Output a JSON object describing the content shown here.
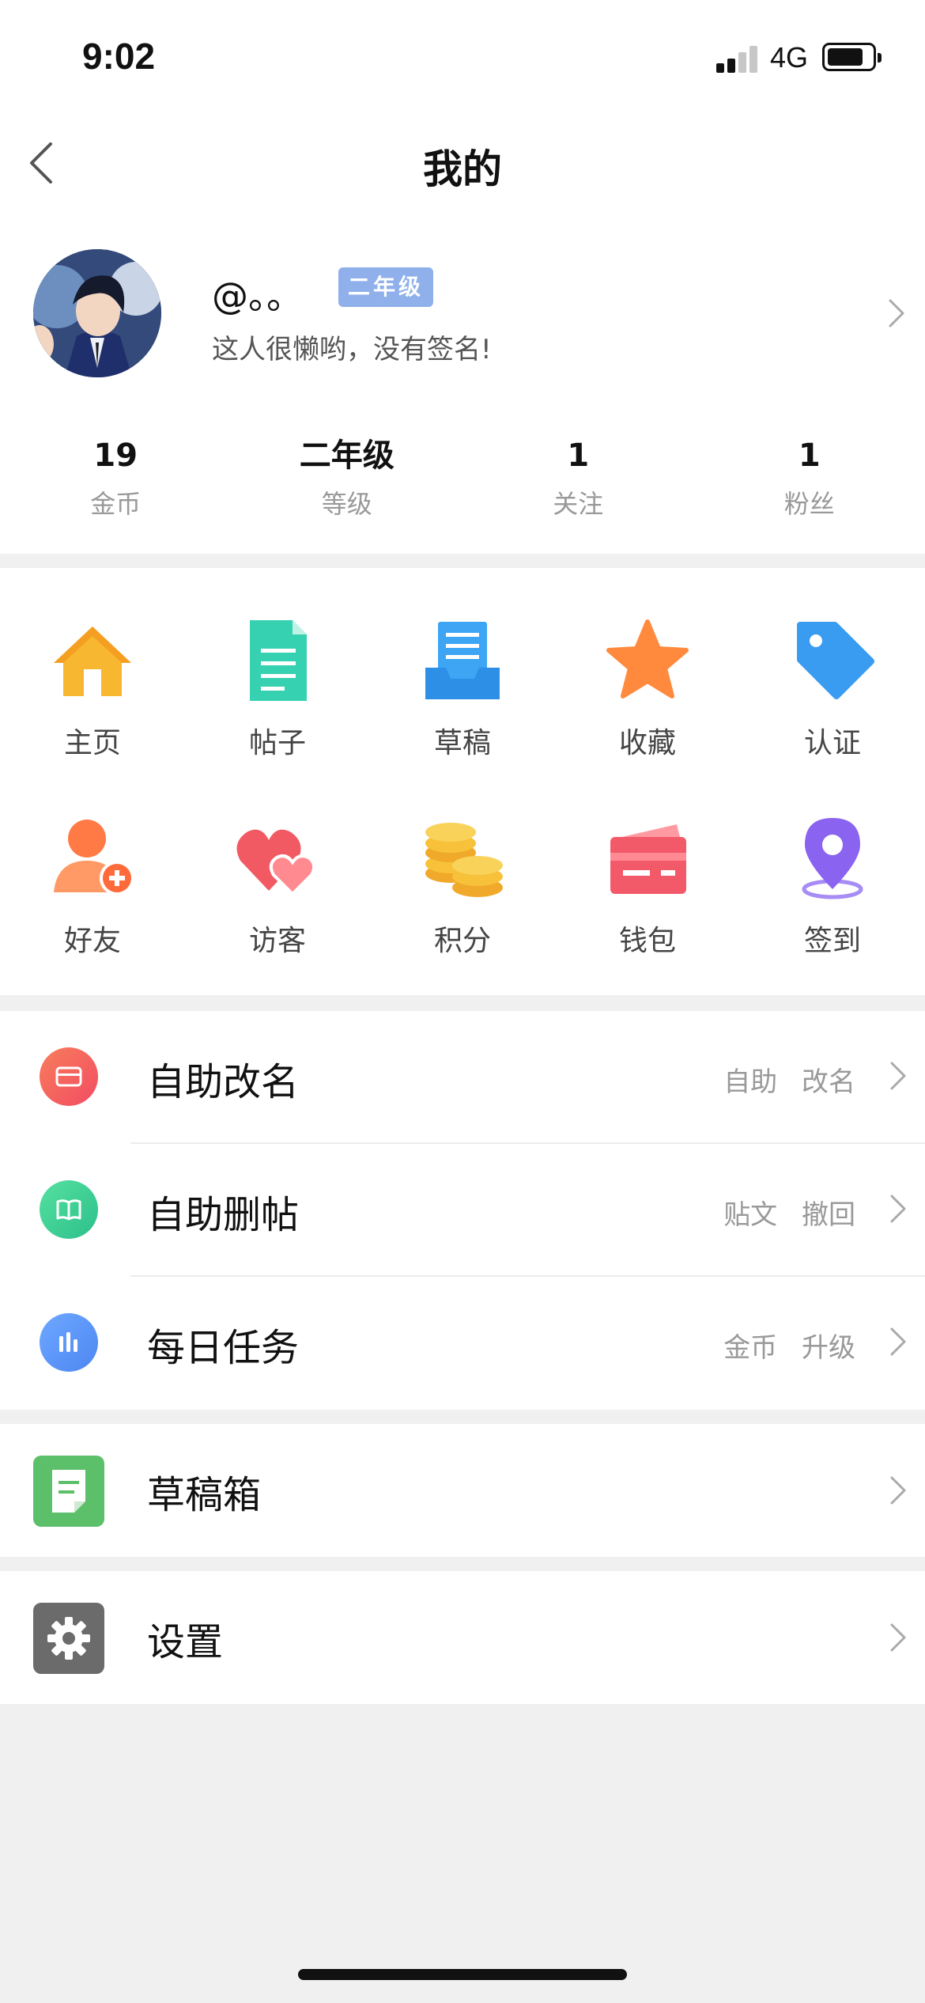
{
  "status": {
    "time": "9:02",
    "network": "4G"
  },
  "nav": {
    "title": "我的"
  },
  "profile": {
    "username": "@。。",
    "level_badge": "二年级",
    "signature": "这人很懒哟，没有签名!"
  },
  "stats": [
    {
      "value": "19",
      "label": "金币"
    },
    {
      "value": "二年级",
      "label": "等级"
    },
    {
      "value": "1",
      "label": "关注"
    },
    {
      "value": "1",
      "label": "粉丝"
    }
  ],
  "grid": [
    {
      "label": "主页",
      "icon": "home-icon",
      "color": "#f7b731"
    },
    {
      "label": "帖子",
      "icon": "document-icon",
      "color": "#36d1b0"
    },
    {
      "label": "草稿",
      "icon": "draft-tray-icon",
      "color": "#3da5f4"
    },
    {
      "label": "收藏",
      "icon": "star-icon",
      "color": "#ff8a3d"
    },
    {
      "label": "认证",
      "icon": "tag-icon",
      "color": "#3a9cf0"
    },
    {
      "label": "好友",
      "icon": "add-friend-icon",
      "color": "#ff7a45"
    },
    {
      "label": "访客",
      "icon": "hearts-icon",
      "color": "#f25a63"
    },
    {
      "label": "积分",
      "icon": "coins-icon",
      "color": "#f7c23a"
    },
    {
      "label": "钱包",
      "icon": "wallet-icon",
      "color": "#f25a6a"
    },
    {
      "label": "签到",
      "icon": "location-pin-icon",
      "color": "#8a63f0"
    }
  ],
  "list": [
    {
      "label": "自助改名",
      "hint": "自助 改名",
      "icon": "card-icon",
      "color": "#f56a5d"
    },
    {
      "label": "自助删帖",
      "hint": "贴文 撤回",
      "icon": "book-icon",
      "color": "#3fcf8e"
    },
    {
      "label": "每日任务",
      "hint": "金币 升级",
      "icon": "bar-chart-icon",
      "color": "#4d9af2"
    }
  ],
  "drafts": {
    "label": "草稿箱",
    "icon": "note-icon",
    "color": "#5cbf6a"
  },
  "settings": {
    "label": "设置",
    "icon": "gear-icon",
    "color": "#6b6b6b"
  }
}
